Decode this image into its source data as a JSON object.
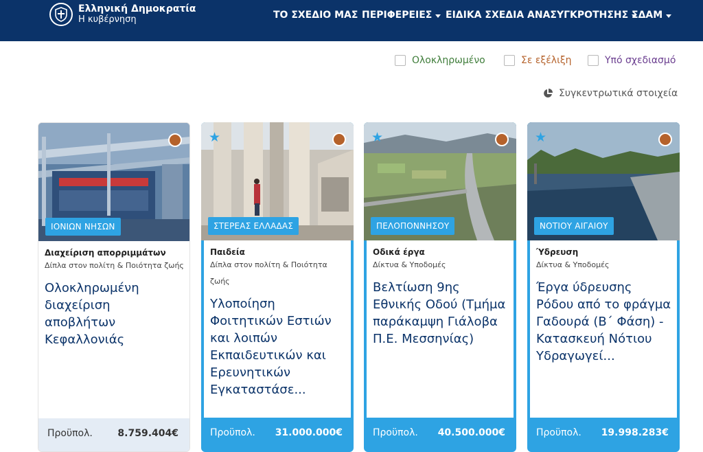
{
  "header": {
    "logo_title": "Ελληνική Δημοκρατία",
    "logo_subtitle": "Η κυβέρνηση",
    "nav": [
      {
        "label": "ΤΟ ΣΧΕΔΙΟ ΜΑΣ",
        "dropdown": false
      },
      {
        "label": "ΠΕΡΙΦΕΡΕΙΕΣ",
        "dropdown": true
      },
      {
        "label": "ΕΙΔΙΚΑ ΣΧΕΔΙΑ ΑΝΑΣΥΓΚΡΟΤΗΣΗΣ",
        "dropdown": true
      },
      {
        "label": "ΣΔΑΜ",
        "dropdown": true
      }
    ]
  },
  "filters": [
    {
      "label": "Ολοκληρωμένο",
      "color": "#3f7d3a",
      "checked": false
    },
    {
      "label": "Σε εξέλιξη",
      "color": "#b5622b",
      "checked": false
    },
    {
      "label": "Υπό σχεδιασμό",
      "color": "#6a3d8f",
      "checked": false
    }
  ],
  "summary_label": "Συγκεντρωτικά στοιχεία",
  "colors": {
    "header_bg": "#0b3369",
    "accent": "#2ea3e3",
    "status_in_progress": "#b5622b",
    "title": "#0b3369"
  },
  "cards": [
    {
      "region": "ΙΟΝΙΩΝ ΝΗΣΩΝ",
      "category": "Διαχείριση απορριμμάτων",
      "subcategory": "Δίπλα στον πολίτη & Ποιότητα ζωής",
      "title": "Ολοκληρωμένη διαχείριση αποβλήτων Κεφαλλονιάς",
      "budget_label": "Προϋπολ.",
      "budget": "8.759.404€",
      "starred": false,
      "status": "Σε εξέλιξη"
    },
    {
      "region": "ΣΤΕΡΕΑΣ ΕΛΛΑΔΑΣ",
      "category": "Παιδεία",
      "subcategory": "Δίπλα στον πολίτη & Ποιότητα ζωής",
      "title": "Υλοποίηση Φοιτητικών Εστιών και λοιπών Εκπαιδευτικών και Ερευνητικών Εγκαταστάσε...",
      "budget_label": "Προϋπολ.",
      "budget": "31.000.000€",
      "starred": true,
      "status": "Σε εξέλιξη"
    },
    {
      "region": "ΠΕΛΟΠΟΝΝΗΣΟΥ",
      "category": "Οδικά έργα",
      "subcategory": "Δίκτυα & Υποδομές",
      "title": "Βελτίωση 9ης Εθνικής Οδού (Τμήμα παράκαμψη Γιάλοβα Π.Ε. Μεσσηνίας)",
      "budget_label": "Προϋπολ.",
      "budget": "40.500.000€",
      "starred": true,
      "status": "Σε εξέλιξη"
    },
    {
      "region": "ΝΟΤΙΟΥ ΑΙΓΑΙΟΥ",
      "category": "Ύδρευση",
      "subcategory": "Δίκτυα & Υποδομές",
      "title": "Έργα ύδρευσης Ρόδου από το φράγμα Γαδουρά (Β΄ Φάση) - Κατασκευή Νότιου Υδραγωγεί...",
      "budget_label": "Προϋπολ.",
      "budget": "19.998.283€",
      "starred": true,
      "status": "Σε εξέλιξη"
    }
  ]
}
